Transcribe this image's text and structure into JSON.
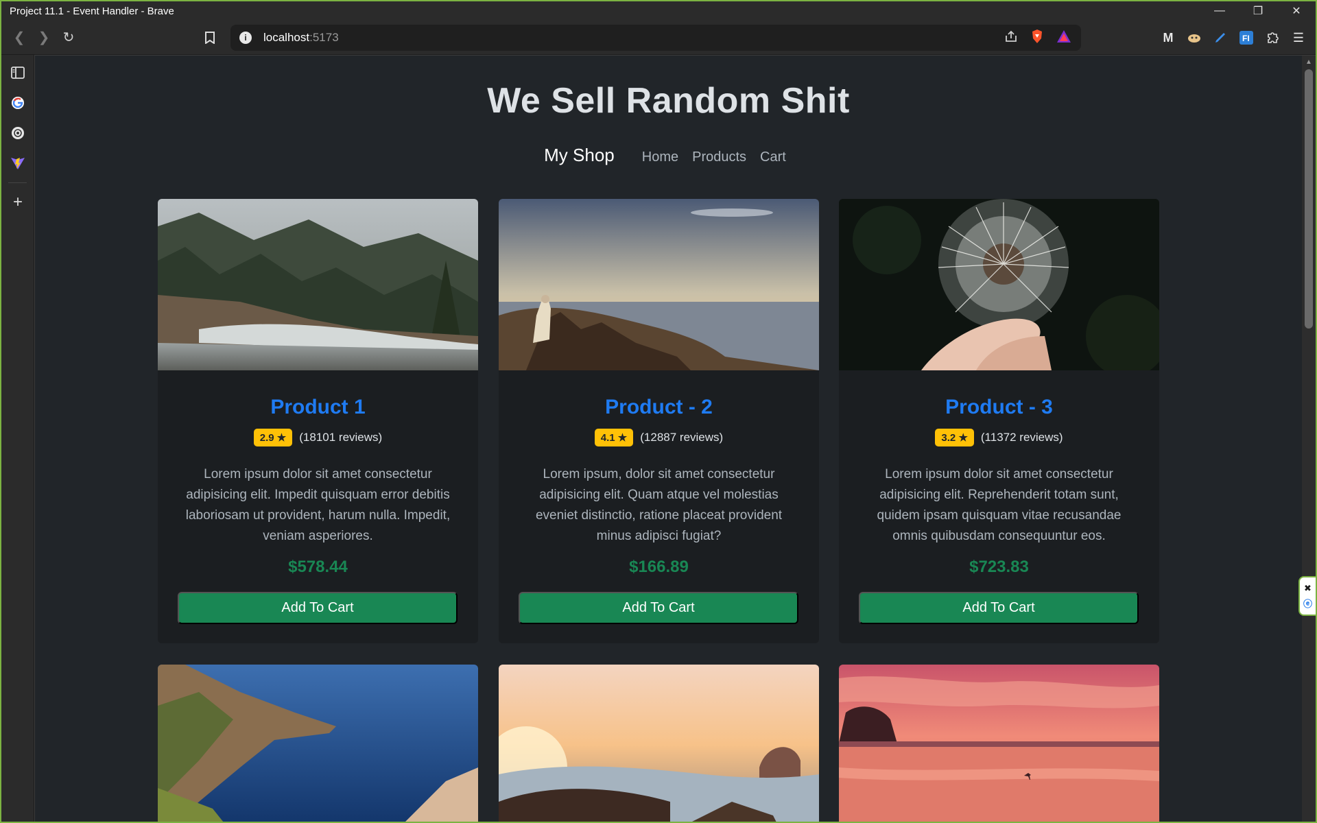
{
  "window": {
    "title": "Project 11.1 - Event Handler - Brave"
  },
  "browser": {
    "url_host": "localhost",
    "url_port": ":5173"
  },
  "page": {
    "heading": "We Sell Random Shit",
    "nav": {
      "brand": "My Shop",
      "links": [
        "Home",
        "Products",
        "Cart"
      ]
    },
    "products": [
      {
        "title": "Product 1",
        "rating": "2.9 ★",
        "reviews": "(18101 reviews)",
        "description": "Lorem ipsum dolor sit amet consectetur adipisicing elit. Impedit quisquam error debitis laboriosam ut provident, harum nulla. Impedit, veniam asperiores.",
        "price": "$578.44",
        "button": "Add To Cart"
      },
      {
        "title": "Product - 2",
        "rating": "4.1 ★",
        "reviews": "(12887 reviews)",
        "description": "Lorem ipsum, dolor sit amet consectetur adipisicing elit. Quam atque vel molestias eveniet distinctio, ratione placeat provident minus adipisci fugiat?",
        "price": "$166.89",
        "button": "Add To Cart"
      },
      {
        "title": "Product - 3",
        "rating": "3.2 ★",
        "reviews": "(11372 reviews)",
        "description": "Lorem ipsum dolor sit amet consectetur adipisicing elit. Reprehenderit totam sunt, quidem ipsam quisquam vitae recusandae omnis quibusdam consequuntur eos.",
        "price": "$723.83",
        "button": "Add To Cart"
      }
    ]
  },
  "colors": {
    "page_bg": "#212529",
    "product_title": "#1f7bf2",
    "price": "#198754",
    "button": "#198754",
    "badge": "#ffc107",
    "window_border": "#7cb342"
  },
  "icons": {
    "toolbar": [
      "back-icon",
      "forward-icon",
      "reload-icon",
      "bookmark-icon",
      "info-icon",
      "share-icon",
      "brave-shield-icon",
      "brave-rewards-icon"
    ],
    "extensions": [
      "m-extension-icon",
      "cat-extension-icon",
      "pen-extension-icon",
      "f-extension-icon",
      "puzzle-icon",
      "menu-icon"
    ],
    "sidebar": [
      "sidebar-toggle-icon",
      "google-icon",
      "chatgpt-icon",
      "vite-icon",
      "add-icon"
    ]
  }
}
